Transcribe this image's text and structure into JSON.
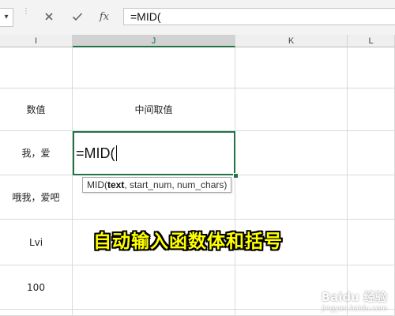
{
  "formula_bar": {
    "name_box_value": "▾",
    "separator": "⋮",
    "cancel_icon": "close-icon",
    "enter_icon": "check-icon",
    "function_label": "fx",
    "formula": "=MID("
  },
  "columns": [
    "I",
    "J",
    "K",
    "L"
  ],
  "active_column": "J",
  "rows": [
    {
      "I": "",
      "J": ""
    },
    {
      "I": "数值",
      "J": "中间取值"
    },
    {
      "I": "我，爱",
      "J": "=MID("
    },
    {
      "I": "哦我，爱吧",
      "J": ""
    },
    {
      "I": "Lvi",
      "J": ""
    },
    {
      "I": "100",
      "J": ""
    },
    {
      "I": "",
      "J": ""
    }
  ],
  "tooltip": {
    "function": "MID(",
    "arg_current": "text",
    "args_rest": ", start_num, num_chars)"
  },
  "annotation": "自动输入函数体和括号",
  "watermark": {
    "main": "Baidu 经验",
    "sub": "jingyan.baidu.com"
  },
  "colors": {
    "accent": "#217346",
    "annotation": "#ffff00"
  }
}
